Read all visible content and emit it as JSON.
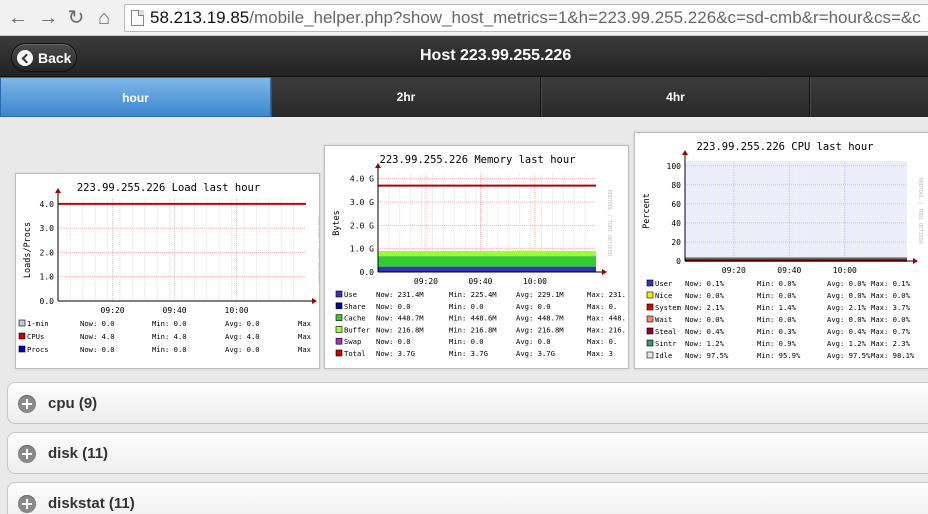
{
  "browser": {
    "url_host": "58.213.19.85",
    "url_rest": "/mobile_helper.php?show_host_metrics=1&h=223.99.255.226&c=sd-cmb&r=hour&cs=&c"
  },
  "header": {
    "back_label": "Back",
    "title": "Host 223.99.255.226"
  },
  "tabs": [
    {
      "label": "hour",
      "active": true
    },
    {
      "label": "2hr",
      "active": false
    },
    {
      "label": "4hr",
      "active": false
    }
  ],
  "watermark": "RRDTOOL / TOBI OETIKER",
  "colors": {
    "grid_major": "#ff9a9a",
    "threshold_line": "#b00000",
    "active_tab": "#3b88cf"
  },
  "chart_data": [
    {
      "type": "line",
      "title": "223.99.255.226 Load last hour",
      "ylabel": "Loads/Procs",
      "y_ticks": [
        "0.0",
        "1.0",
        "2.0",
        "3.0",
        "4.0"
      ],
      "x_ticks": [
        "09:20",
        "09:40",
        "10:00"
      ],
      "ylim": [
        0,
        4.2
      ],
      "series": [
        {
          "name": "1-min",
          "color": "#c8c8c8",
          "values": [
            0,
            0,
            0,
            0,
            0,
            0,
            0
          ]
        },
        {
          "name": "CPUs",
          "color": "#cc0000",
          "values": [
            4,
            4,
            4,
            4,
            4,
            4,
            4
          ]
        },
        {
          "name": "Procs",
          "color": "#0000cc",
          "values": [
            0,
            0,
            0,
            0,
            0,
            0,
            0
          ]
        }
      ],
      "legend_rows": [
        {
          "label": "1-min",
          "color": "#c8c8c8",
          "now": "Now:  0.0",
          "min": "Min:  0.0",
          "avg": "Avg:  0.0",
          "max": "Max"
        },
        {
          "label": "CPUs",
          "color": "#cc0000",
          "now": "Now:  4.0",
          "min": "Min:  4.0",
          "avg": "Avg:  4.0",
          "max": "Max"
        },
        {
          "label": "Procs",
          "color": "#0000cc",
          "now": "Now:  0.0",
          "min": "Min:  0.0",
          "avg": "Avg:  0.0",
          "max": "Max"
        }
      ]
    },
    {
      "type": "area",
      "title": "223.99.255.226 Memory last hour",
      "ylabel": "Bytes",
      "y_ticks": [
        "0.0",
        "1.0 G",
        "2.0 G",
        "3.0 G",
        "4.0 G"
      ],
      "x_ticks": [
        "09:20",
        "09:40",
        "10:00"
      ],
      "ylim": [
        0,
        4.2
      ],
      "total_line": 3.7,
      "series": [
        {
          "name": "Use",
          "color": "#3333bb",
          "values": [
            0.23,
            0.23,
            0.23,
            0.23,
            0.23,
            0.23,
            0.23
          ]
        },
        {
          "name": "Share",
          "color": "#0000aa",
          "values": [
            0,
            0,
            0,
            0,
            0,
            0,
            0
          ]
        },
        {
          "name": "Cache",
          "color": "#33cc33",
          "values": [
            0.45,
            0.45,
            0.45,
            0.45,
            0.45,
            0.45,
            0.45
          ]
        },
        {
          "name": "Buffer",
          "color": "#99ff33",
          "values": [
            0.22,
            0.22,
            0.22,
            0.22,
            0.24,
            0.22,
            0.22
          ]
        },
        {
          "name": "Swap",
          "color": "#9933cc",
          "values": [
            0,
            0,
            0,
            0,
            0,
            0,
            0
          ]
        }
      ],
      "legend_rows": [
        {
          "label": "Use",
          "color": "#3333bb",
          "now": "Now:  231.4M",
          "min": "Min:  225.4M",
          "avg": "Avg:  229.1M",
          "max": "Max:  231."
        },
        {
          "label": "Share",
          "color": "#0000aa",
          "now": "Now:    0.0",
          "min": "Min:    0.0",
          "avg": "Avg:    0.0",
          "max": "Max:   0."
        },
        {
          "label": "Cache",
          "color": "#33cc33",
          "now": "Now:  448.7M",
          "min": "Min:  448.6M",
          "avg": "Avg:  448.7M",
          "max": "Max:  448."
        },
        {
          "label": "Buffer",
          "color": "#99ff33",
          "now": "Now:  216.8M",
          "min": "Min:  216.8M",
          "avg": "Avg:  216.8M",
          "max": "Max:  216."
        },
        {
          "label": "Swap",
          "color": "#9933cc",
          "now": "Now:    0.0",
          "min": "Min:    0.0",
          "avg": "Avg:    0.0",
          "max": "Max:   0."
        },
        {
          "label": "Total",
          "color": "#cc0000",
          "now": "Now:    3.7G",
          "min": "Min:    3.7G",
          "avg": "Avg:    3.7G",
          "max": "Max:   3"
        }
      ]
    },
    {
      "type": "area",
      "title": "223.99.255.226 CPU last hour",
      "ylabel": "Percent",
      "y_ticks": [
        "0",
        "20",
        "40",
        "60",
        "80",
        "100"
      ],
      "x_ticks": [
        "09:20",
        "09:40",
        "10:00"
      ],
      "ylim": [
        0,
        105
      ],
      "series": [
        {
          "name": "User",
          "color": "#3333bb",
          "values": [
            0.1,
            0.1,
            0.1,
            0.1,
            0.1,
            0.1,
            0.1
          ]
        },
        {
          "name": "Nice",
          "color": "#ffea00",
          "values": [
            0,
            0,
            0,
            0,
            0,
            0,
            0
          ]
        },
        {
          "name": "System",
          "color": "#dd0000",
          "values": [
            2.1,
            2.1,
            2.1,
            2.1,
            2.1,
            2.1,
            2.1
          ]
        },
        {
          "name": "Wait",
          "color": "#ff8a60",
          "values": [
            0,
            0,
            0,
            0,
            0,
            0,
            0
          ]
        },
        {
          "name": "Steal",
          "color": "#990033",
          "values": [
            0.4,
            0.4,
            0.4,
            0.4,
            0.4,
            0.4,
            0.4
          ]
        },
        {
          "name": "Sintr",
          "color": "#339966",
          "values": [
            1.2,
            1.2,
            1.2,
            1.2,
            1.2,
            1.2,
            1.2
          ]
        },
        {
          "name": "Idle",
          "color": "#e3e3f7",
          "values": [
            97.5,
            97.5,
            97.5,
            97.5,
            97.5,
            97.5,
            97.5
          ]
        }
      ],
      "legend_rows": [
        {
          "label": "User",
          "color": "#3333bb",
          "now": "Now:  0.1%",
          "min": "Min:  0.0%",
          "avg": "Avg:  0.0%",
          "max": "Max:  0.1%"
        },
        {
          "label": "Nice",
          "color": "#ffea00",
          "now": "Now:  0.0%",
          "min": "Min:  0.0%",
          "avg": "Avg:  0.0%",
          "max": "Max:  0.0%"
        },
        {
          "label": "System",
          "color": "#dd0000",
          "now": "Now:  2.1%",
          "min": "Min:  1.4%",
          "avg": "Avg:  2.1%",
          "max": "Max:  3.7%"
        },
        {
          "label": "Wait",
          "color": "#ff8a60",
          "now": "Now:  0.0%",
          "min": "Min:  0.0%",
          "avg": "Avg:  0.0%",
          "max": "Max:  0.0%"
        },
        {
          "label": "Steal",
          "color": "#990033",
          "now": "Now:  0.4%",
          "min": "Min:  0.3%",
          "avg": "Avg:  0.4%",
          "max": "Max:  0.7%"
        },
        {
          "label": "Sintr",
          "color": "#339966",
          "now": "Now:  1.2%",
          "min": "Min:  0.9%",
          "avg": "Avg:  1.2%",
          "max": "Max:  2.3%"
        },
        {
          "label": "Idle",
          "color": "#e3e3f7",
          "now": "Now: 97.5%",
          "min": "Min: 95.9%",
          "avg": "Avg: 97.5%",
          "max": "Max: 98.1%"
        }
      ]
    }
  ],
  "sections": [
    {
      "label": "cpu (9)"
    },
    {
      "label": "disk (11)"
    },
    {
      "label": "diskstat (11)"
    }
  ]
}
